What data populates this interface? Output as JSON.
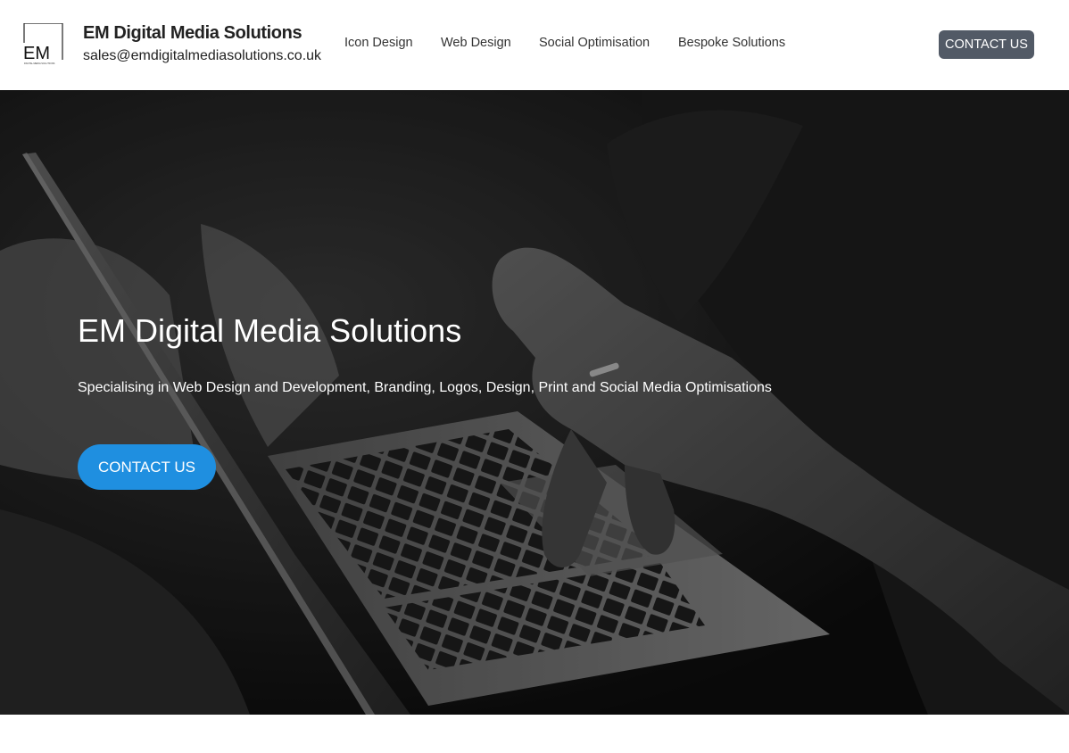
{
  "header": {
    "logo_text": "EM",
    "logo_subtext": "DIGITAL MEDIA SOLUTIONS",
    "brand_name": "EM Digital Media Solutions",
    "email": "sales@emdigitalmediasolutions.co.uk",
    "nav": [
      {
        "label": "Icon Design"
      },
      {
        "label": "Web Design"
      },
      {
        "label": "Social Optimisation"
      },
      {
        "label": "Bespoke Solutions"
      }
    ],
    "cta_label": "CONTACT US"
  },
  "hero": {
    "title": "EM Digital Media Solutions",
    "subtitle": "Specialising in Web Design and Development, Branding, Logos, Design, Print and Social Media Optimisations",
    "cta_label": "CONTACT US",
    "image": "laptop-hands-photo"
  },
  "colors": {
    "header_cta_bg": "#525a66",
    "hero_cta_bg": "#1f8fe0",
    "text_dark": "#222222"
  }
}
